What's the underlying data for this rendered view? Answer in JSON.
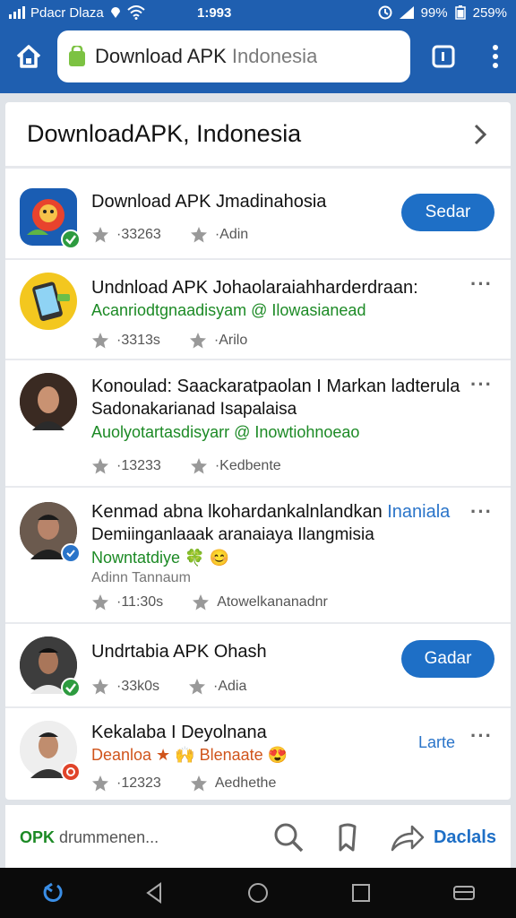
{
  "status_bar": {
    "carrier": "Pdacr Dlaza",
    "time": "1:993",
    "battery_left": "99%",
    "battery_right": "259%"
  },
  "browser": {
    "url_main": "Download APK",
    "url_dim": "Indonesia"
  },
  "page": {
    "title": "DownloadAPK, Indonesia"
  },
  "items": [
    {
      "title": "Download APK Jmadinahosia",
      "stat1": "·33263",
      "stat2": "·Adin",
      "button": "Sedar"
    },
    {
      "title": "Undnload APK Johaolaraiahharderdraan:",
      "green_line": "Acanriodtgnaadisyam @ Ilowasianead",
      "stat1": "·3313s",
      "stat2": "·Arilo"
    },
    {
      "title": "Konoulad: Saackaratpaolan I Markan ladterula",
      "line2": "Sadonakarianad Isapalaisa",
      "green_line": "Auolyotartasdisyarr @ Inowtiohnoeao",
      "stat1": "·13233",
      "stat2": "·Kedbente"
    },
    {
      "title_black": "Kenmad abna lkohardankalnlandkan",
      "title_blue": "Inaniala",
      "line2": "Demiinganlaaak aranaiaya Ilangmisia",
      "green_line": "Nowntatdiye 🍀 😊",
      "grey_line": "Adinn Tannaum",
      "stat1": "·11:30s",
      "stat2": "Atowelkananadnr"
    },
    {
      "title": "Undrtabia APK Ohash",
      "stat1": "·33k0s",
      "stat2": "·Adia",
      "button": "Gadar"
    },
    {
      "title": "Kekalaba I Deyolnana",
      "orange_line": "Deanloa ★ 🙌 Blenaate 😍",
      "stat1": "·12323",
      "stat2": "Aedhethe",
      "later": "Larte"
    }
  ],
  "action_bar": {
    "tag_green": "OPK",
    "tag_rest": "drummenen..."
  },
  "action_bar_right": "Daclals",
  "colors": {
    "brand_blue": "#1f5fb0",
    "button_blue": "#1e6fc6",
    "green_text": "#1c8a25"
  }
}
